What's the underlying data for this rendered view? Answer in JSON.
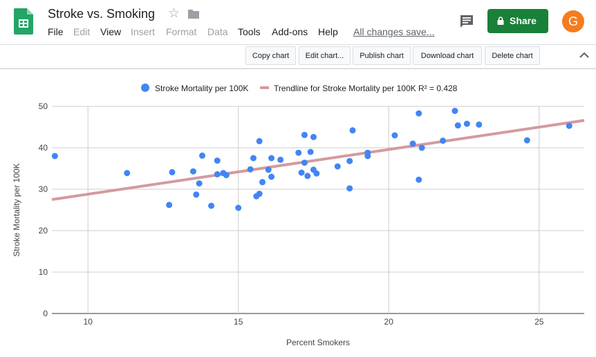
{
  "app": {
    "title": "Stroke vs. Smoking",
    "menu": [
      "File",
      "Edit",
      "View",
      "Insert",
      "Format",
      "Data",
      "Tools",
      "Add-ons",
      "Help"
    ],
    "saved_status": "All changes save...",
    "share_label": "Share",
    "avatar_letter": "G"
  },
  "toolbar": {
    "buttons": [
      "Copy chart",
      "Edit chart...",
      "Publish chart",
      "Download chart",
      "Delete chart"
    ]
  },
  "colors": {
    "brand_green": "#188038",
    "point": "#4285f4",
    "trendline": "#d49a9e",
    "avatar": "#f57c1f"
  },
  "chart_data": {
    "type": "scatter",
    "xlabel": "Percent Smokers",
    "ylabel": "Stroke Mortality per 100K",
    "xlim": [
      8.8,
      26.5
    ],
    "ylim": [
      0,
      50
    ],
    "xticks": [
      "10",
      "15",
      "20",
      "25"
    ],
    "yticks": [
      "0",
      "10",
      "20",
      "30",
      "40",
      "50"
    ],
    "grid": true,
    "legend_position": "top",
    "legend": [
      "Stroke Mortality per 100K",
      "Trendline for Stroke Mortality per 100K R² = 0.428"
    ],
    "series": [
      {
        "name": "Stroke Mortality per 100K",
        "points": [
          [
            8.9,
            38.0
          ],
          [
            11.3,
            33.9
          ],
          [
            12.7,
            26.2
          ],
          [
            12.8,
            34.1
          ],
          [
            13.5,
            34.3
          ],
          [
            13.6,
            28.7
          ],
          [
            13.7,
            31.4
          ],
          [
            13.8,
            38.1
          ],
          [
            14.1,
            26.0
          ],
          [
            14.3,
            36.9
          ],
          [
            14.3,
            33.6
          ],
          [
            14.5,
            33.9
          ],
          [
            14.6,
            33.4
          ],
          [
            15.0,
            25.5
          ],
          [
            15.4,
            34.8
          ],
          [
            15.5,
            37.5
          ],
          [
            15.6,
            28.3
          ],
          [
            15.7,
            28.9
          ],
          [
            15.7,
            41.6
          ],
          [
            15.8,
            31.7
          ],
          [
            16.0,
            34.7
          ],
          [
            16.1,
            33.0
          ],
          [
            16.1,
            37.5
          ],
          [
            16.4,
            37.1
          ],
          [
            17.0,
            38.8
          ],
          [
            17.1,
            34.0
          ],
          [
            17.2,
            36.4
          ],
          [
            17.2,
            43.1
          ],
          [
            17.3,
            33.2
          ],
          [
            17.4,
            39.0
          ],
          [
            17.5,
            42.6
          ],
          [
            17.5,
            34.7
          ],
          [
            17.6,
            33.8
          ],
          [
            18.3,
            35.5
          ],
          [
            18.7,
            30.2
          ],
          [
            18.7,
            36.8
          ],
          [
            18.8,
            44.2
          ],
          [
            19.3,
            38.8
          ],
          [
            19.3,
            38.0
          ],
          [
            20.2,
            43.0
          ],
          [
            20.8,
            41.0
          ],
          [
            21.0,
            48.3
          ],
          [
            21.0,
            32.3
          ],
          [
            21.1,
            40.0
          ],
          [
            21.8,
            41.7
          ],
          [
            22.2,
            48.9
          ],
          [
            22.3,
            45.4
          ],
          [
            22.6,
            45.8
          ],
          [
            23.0,
            45.6
          ],
          [
            24.6,
            41.8
          ],
          [
            26.0,
            45.3
          ]
        ]
      }
    ],
    "trendline": {
      "name": "Trendline for Stroke Mortality per 100K",
      "r_squared": 0.428,
      "x": [
        8.8,
        26.5
      ],
      "y": [
        27.5,
        46.6
      ]
    }
  }
}
